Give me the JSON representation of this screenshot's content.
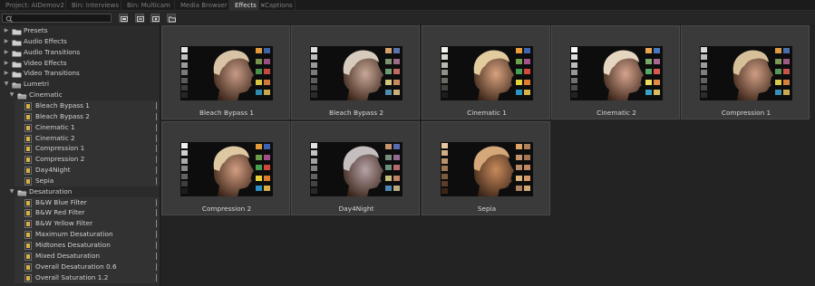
{
  "tabs": [
    {
      "label": "Project: AIDemov2",
      "active": false
    },
    {
      "label": "Bin: Interviews",
      "active": false
    },
    {
      "label": "Bin: Multicam",
      "active": false
    },
    {
      "label": "Media Browser",
      "active": false
    },
    {
      "label": "Effects",
      "active": true
    },
    {
      "label": "Captions",
      "active": false
    }
  ],
  "tab_close_glyph": "×",
  "search": {
    "placeholder": "",
    "icon": "search-icon"
  },
  "toolbar_buttons": [
    "accelerated-effects-icon",
    "32bit-effects-icon",
    "yuv-effects-icon",
    "new-bin-icon"
  ],
  "tree": [
    {
      "label": "Presets",
      "level": 0,
      "kind": "folder",
      "expanded": false
    },
    {
      "label": "Audio Effects",
      "level": 0,
      "kind": "folder",
      "expanded": false
    },
    {
      "label": "Audio Transitions",
      "level": 0,
      "kind": "folder",
      "expanded": false
    },
    {
      "label": "Video Effects",
      "level": 0,
      "kind": "folder",
      "expanded": false
    },
    {
      "label": "Video Transitions",
      "level": 0,
      "kind": "folder",
      "expanded": false
    },
    {
      "label": "Lumetri",
      "level": 0,
      "kind": "folder",
      "expanded": true
    },
    {
      "label": "Cinematic",
      "level": 1,
      "kind": "folder",
      "expanded": true
    },
    {
      "label": "Bleach Bypass 1",
      "level": 2,
      "kind": "preset"
    },
    {
      "label": "Bleach Bypass 2",
      "level": 2,
      "kind": "preset"
    },
    {
      "label": "Cinematic 1",
      "level": 2,
      "kind": "preset"
    },
    {
      "label": "Cinematic 2",
      "level": 2,
      "kind": "preset"
    },
    {
      "label": "Compression 1",
      "level": 2,
      "kind": "preset"
    },
    {
      "label": "Compression 2",
      "level": 2,
      "kind": "preset"
    },
    {
      "label": "Day4Night",
      "level": 2,
      "kind": "preset"
    },
    {
      "label": "Sepia",
      "level": 2,
      "kind": "preset"
    },
    {
      "label": "Desaturation",
      "level": 1,
      "kind": "folder",
      "expanded": true
    },
    {
      "label": "B&W Blue Filter",
      "level": 2,
      "kind": "preset"
    },
    {
      "label": "B&W Red Filter",
      "level": 2,
      "kind": "preset"
    },
    {
      "label": "B&W Yellow Filter",
      "level": 2,
      "kind": "preset"
    },
    {
      "label": "Maximum Desaturation",
      "level": 2,
      "kind": "preset"
    },
    {
      "label": "Midtones Desaturation",
      "level": 2,
      "kind": "preset"
    },
    {
      "label": "Mixed Desaturation",
      "level": 2,
      "kind": "preset"
    },
    {
      "label": "Overall Desaturation 0.6",
      "level": 2,
      "kind": "preset"
    },
    {
      "label": "Overall Saturation 1.2",
      "level": 2,
      "kind": "preset"
    }
  ],
  "presets": [
    {
      "name": "Bleach Bypass 1",
      "skin": "#c79a86",
      "hair": "#d8c3a6",
      "greys": [
        "#e8e8e8",
        "#c0c0c0",
        "#9a9a9a",
        "#7a7a7a",
        "#5a5a5a",
        "#3c3c3c",
        "#262626"
      ],
      "swatches": [
        "#e09a3c",
        "#3e63a6",
        "#7a9250",
        "#9b4f80",
        "#4a8f4c",
        "#c44a3e",
        "#d7c440",
        "#d07a3a",
        "#2d8ab0",
        "#c7a84e"
      ]
    },
    {
      "name": "Bleach Bypass 2",
      "skin": "#c8a898",
      "hair": "#d6cbbd",
      "greys": [
        "#e0e0e0",
        "#bdbdbd",
        "#9a9a9a",
        "#7a7a7a",
        "#5e5e5e",
        "#414141",
        "#2a2a2a"
      ],
      "swatches": [
        "#d3a06a",
        "#5b74a8",
        "#7f9270",
        "#9b6a88",
        "#6e9a72",
        "#c06a60",
        "#d2c67a",
        "#c78a5e",
        "#4c8eaa",
        "#c9b07a"
      ]
    },
    {
      "name": "Cinematic 1",
      "skin": "#d8a27e",
      "hair": "#e2cc9e",
      "greys": [
        "#f4f4f0",
        "#d8d8d2",
        "#b8b8b2",
        "#909088",
        "#6a6a64",
        "#42423e",
        "#1c1c1a"
      ],
      "swatches": [
        "#ea9b3a",
        "#3f66b2",
        "#6ea04e",
        "#a5528a",
        "#45a052",
        "#d44a3c",
        "#e8d23c",
        "#e07c30",
        "#2a94c4",
        "#d8b24a"
      ]
    },
    {
      "name": "Cinematic 2",
      "skin": "#d5a48e",
      "hair": "#e4d6c0",
      "greys": [
        "#fafafa",
        "#dedede",
        "#bcbcbc",
        "#969696",
        "#707070",
        "#4a4a4a",
        "#222222"
      ],
      "swatches": [
        "#e8a650",
        "#4a78c0",
        "#7aa86a",
        "#a9668e",
        "#5aa866",
        "#d85a50",
        "#eedc5a",
        "#e48a48",
        "#3aa0c8",
        "#dcbc62"
      ]
    },
    {
      "name": "Compression 1",
      "skin": "#cf9e84",
      "hair": "#d6c09a",
      "greys": [
        "#d8d8d8",
        "#bababa",
        "#9c9c9c",
        "#7e7e7e",
        "#626262",
        "#464646",
        "#2c2c2c"
      ],
      "swatches": [
        "#dd9a44",
        "#4a6eaa",
        "#7a9858",
        "#9c5a86",
        "#58985a",
        "#c8544a",
        "#dcc84a",
        "#d4803e",
        "#3890b6",
        "#ccaa52"
      ]
    },
    {
      "name": "Compression 2",
      "skin": "#d39e82",
      "hair": "#ddc8a2",
      "greys": [
        "#f0f0f0",
        "#cfcfcf",
        "#aaaaaa",
        "#868686",
        "#626262",
        "#3e3e3e",
        "#1c1c1c"
      ],
      "swatches": [
        "#e39a3a",
        "#3c62b0",
        "#6a9c4a",
        "#a24e88",
        "#44a04e",
        "#d2463a",
        "#e6d03a",
        "#de7a2e",
        "#2890c2",
        "#d6ae46"
      ]
    },
    {
      "name": "Day4Night",
      "skin": "#b6a2a6",
      "hair": "#c4bebe",
      "greys": [
        "#e2e2e2",
        "#c2c2c2",
        "#a0a0a0",
        "#808080",
        "#626262",
        "#444444",
        "#282828"
      ],
      "swatches": [
        "#c4966a",
        "#5a6cb0",
        "#7a8c80",
        "#946a92",
        "#6c8e7c",
        "#b86a6a",
        "#c8be7c",
        "#c08466",
        "#4e88b2",
        "#bcaa80"
      ]
    },
    {
      "name": "Sepia",
      "skin": "#c88a5a",
      "hair": "#d4a878",
      "greys": [
        "#e8c8a0",
        "#d2ae84",
        "#b8946a",
        "#9a7652",
        "#7c5a3c",
        "#5c3e28",
        "#3a2618"
      ],
      "swatches": [
        "#e0a468",
        "#b08058",
        "#c49670",
        "#a47254",
        "#b88c66",
        "#c48660",
        "#dcb47c",
        "#d49868",
        "#ac8260",
        "#d2a876"
      ]
    }
  ]
}
